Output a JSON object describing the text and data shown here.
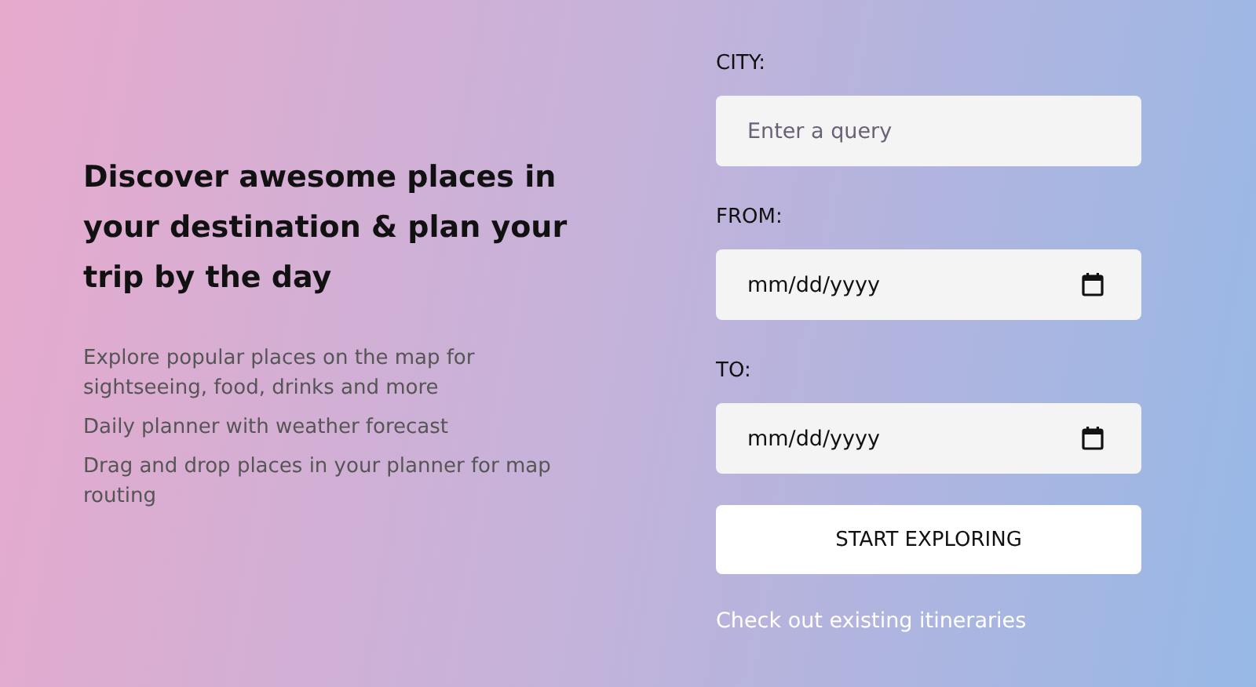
{
  "intro": {
    "heading": "Discover awesome places in your destination & plan your trip by the day",
    "features": [
      "Explore popular places on the map for sightseeing, food, drinks and more",
      "Daily planner with weather forecast",
      "Drag and drop places in your planner for map routing"
    ]
  },
  "form": {
    "fields": [
      {
        "kind": "text",
        "label": "CITY:",
        "placeholder": "Enter a query"
      },
      {
        "kind": "date",
        "label": "FROM:",
        "placeholder": "mm/dd/yyyy"
      },
      {
        "kind": "date",
        "label": "TO:",
        "placeholder": "mm/dd/yyyy"
      }
    ],
    "button": "START EXPLORING",
    "link": "Check out existing itineraries"
  }
}
